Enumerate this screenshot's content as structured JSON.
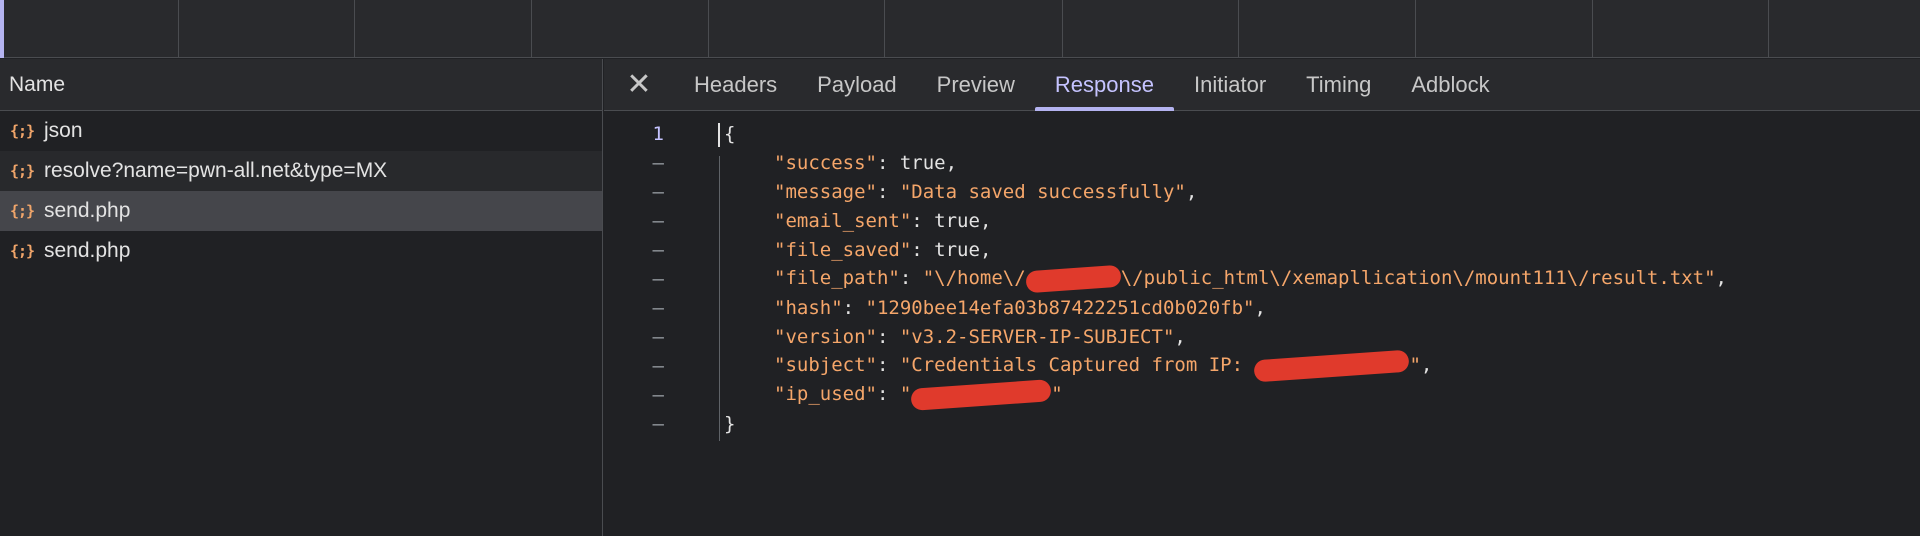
{
  "left_pane": {
    "column_header": "Name",
    "requests": [
      {
        "icon": "json-icon",
        "name": "json"
      },
      {
        "icon": "json-icon",
        "name": "resolve?name=pwn-all.net&type=MX"
      },
      {
        "icon": "json-icon",
        "name": "send.php"
      },
      {
        "icon": "json-icon",
        "name": "send.php"
      }
    ],
    "icon_glyph": "{;}"
  },
  "detail": {
    "close_glyph": "✕",
    "tabs": [
      "Headers",
      "Payload",
      "Preview",
      "Response",
      "Initiator",
      "Timing",
      "Adblock"
    ],
    "active_tab": "Response"
  },
  "response": {
    "first_line_number": "1",
    "fold_marker": "–",
    "open_brace": "{",
    "close_brace": "}",
    "fields": [
      {
        "key": "\"success\"",
        "value": "true",
        "kind": "bool"
      },
      {
        "key": "\"message\"",
        "value": "\"Data saved successfully\"",
        "kind": "str"
      },
      {
        "key": "\"email_sent\"",
        "value": "true",
        "kind": "bool"
      },
      {
        "key": "\"file_saved\"",
        "value": "true",
        "kind": "bool"
      },
      {
        "key": "\"file_path\"",
        "value_prefix": "\"\\/home\\/",
        "value_suffix": "\\/public_html\\/xemapllication\\/mount111\\/result.txt\"",
        "kind": "redacted"
      },
      {
        "key": "\"hash\"",
        "value": "\"1290bee14efa03b87422251cd0b020fb\"",
        "kind": "str"
      },
      {
        "key": "\"version\"",
        "value": "\"v3.2-SERVER-IP-SUBJECT\"",
        "kind": "str"
      },
      {
        "key": "\"subject\"",
        "value_prefix": "\"Credentials Captured from IP: ",
        "value_suffix": "\"",
        "kind": "redacted"
      },
      {
        "key": "\"ip_used\"",
        "value_prefix": "\"",
        "value_suffix": "\"",
        "kind": "redacted"
      }
    ]
  },
  "colors": {
    "accent": "#b4b3f0",
    "json_key": "#f5a66a",
    "redaction": "#e03a2c",
    "selected_row": "#45464b"
  }
}
